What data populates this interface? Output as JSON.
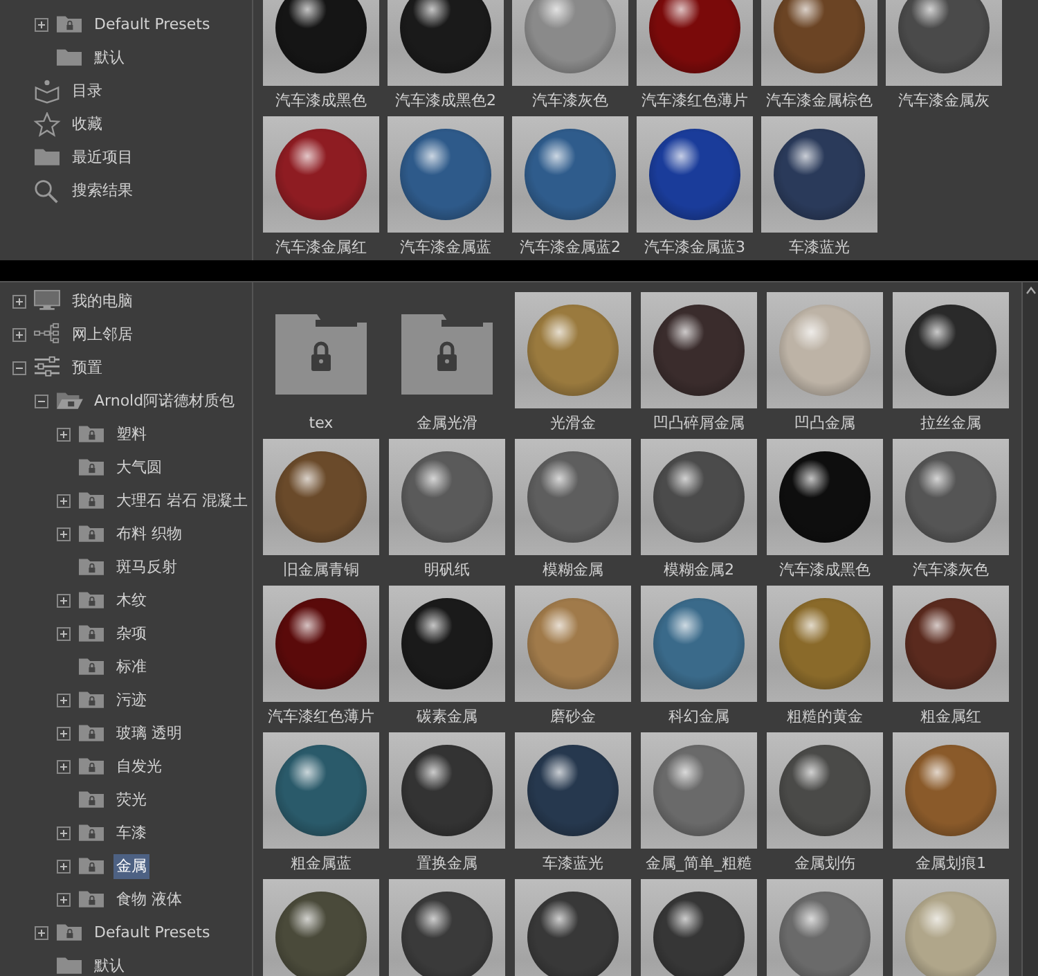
{
  "top_panel": {
    "tree": {
      "items": [
        {
          "children": [
            {
              "label": "Default Presets",
              "kind": "locked-folder",
              "expanded": false,
              "selected": false
            },
            {
              "label": "默认",
              "kind": "folder",
              "selected": false
            }
          ]
        },
        {
          "label": "目录",
          "kind": "book",
          "selected": false
        },
        {
          "label": "收藏",
          "kind": "star",
          "selected": false
        },
        {
          "label": "最近项目",
          "kind": "folder",
          "selected": false
        },
        {
          "label": "搜索结果",
          "kind": "search",
          "selected": false
        }
      ]
    },
    "grid": [
      {
        "kind": "material",
        "label": "汽车漆成黑色",
        "color": "#151515"
      },
      {
        "kind": "material",
        "label": "汽车漆成黑色2",
        "color": "#1a1a1a"
      },
      {
        "kind": "material",
        "label": "汽车漆灰色",
        "color": "#8a8a8a"
      },
      {
        "kind": "material",
        "label": "汽车漆红色薄片",
        "color": "#7a0a0a"
      },
      {
        "kind": "material",
        "label": "汽车漆金属棕色",
        "color": "#6b4424"
      },
      {
        "kind": "material",
        "label": "汽车漆金属灰",
        "color": "#4a4a4a"
      },
      {
        "kind": "material",
        "label": "汽车漆金属红",
        "color": "#8e1c22"
      },
      {
        "kind": "material",
        "label": "汽车漆金属蓝",
        "color": "#2e5a8a"
      },
      {
        "kind": "material",
        "label": "汽车漆金属蓝2",
        "color": "#2f5c8c"
      },
      {
        "kind": "material",
        "label": "汽车漆金属蓝3",
        "color": "#1a3c9a"
      },
      {
        "kind": "material",
        "label": "车漆蓝光",
        "color": "#2a3a5a"
      }
    ]
  },
  "bottom_panel": {
    "tree": {
      "items": [
        {
          "label": "我的电脑",
          "kind": "computer",
          "expanded": false,
          "selected": false
        },
        {
          "label": "网上邻居",
          "kind": "network",
          "expanded": false,
          "selected": false
        },
        {
          "label": "预置",
          "kind": "sliders",
          "expanded": true,
          "selected": false,
          "children": [
            {
              "label": "Arnold阿诺德材质包",
              "kind": "open-locked-folder",
              "expanded": true,
              "selected": false,
              "children": [
                {
                  "label": "塑料",
                  "kind": "locked-folder",
                  "expanded": false,
                  "selected": false
                },
                {
                  "label": "大气圆",
                  "kind": "locked-folder",
                  "selected": false
                },
                {
                  "label": "大理石 岩石 混凝土",
                  "kind": "locked-folder",
                  "expanded": false,
                  "selected": false
                },
                {
                  "label": "布料 织物",
                  "kind": "locked-folder",
                  "expanded": false,
                  "selected": false
                },
                {
                  "label": "斑马反射",
                  "kind": "locked-folder",
                  "selected": false
                },
                {
                  "label": "木纹",
                  "kind": "locked-folder",
                  "expanded": false,
                  "selected": false
                },
                {
                  "label": "杂项",
                  "kind": "locked-folder",
                  "expanded": false,
                  "selected": false
                },
                {
                  "label": "标准",
                  "kind": "locked-folder",
                  "selected": false
                },
                {
                  "label": "污迹",
                  "kind": "locked-folder",
                  "expanded": false,
                  "selected": false
                },
                {
                  "label": "玻璃 透明",
                  "kind": "locked-folder",
                  "expanded": false,
                  "selected": false
                },
                {
                  "label": "自发光",
                  "kind": "locked-folder",
                  "expanded": false,
                  "selected": false
                },
                {
                  "label": "荧光",
                  "kind": "locked-folder",
                  "selected": false
                },
                {
                  "label": "车漆",
                  "kind": "locked-folder",
                  "expanded": false,
                  "selected": false
                },
                {
                  "label": "金属",
                  "kind": "locked-folder",
                  "expanded": false,
                  "selected": true
                },
                {
                  "label": "食物 液体",
                  "kind": "locked-folder",
                  "expanded": false,
                  "selected": false
                }
              ]
            },
            {
              "label": "Default Presets",
              "kind": "locked-folder",
              "expanded": false,
              "selected": false
            },
            {
              "label": "默认",
              "kind": "folder",
              "selected": false
            }
          ]
        }
      ]
    },
    "grid": [
      {
        "kind": "folder",
        "label": "tex"
      },
      {
        "kind": "folder",
        "label": "金属光滑"
      },
      {
        "kind": "material",
        "label": "光滑金",
        "color": "#9a7a3e"
      },
      {
        "kind": "material",
        "label": "凹凸碎屑金属",
        "color": "#3a2c2c"
      },
      {
        "kind": "material",
        "label": "凹凸金属",
        "color": "#bdb3a6"
      },
      {
        "kind": "material",
        "label": "拉丝金属",
        "color": "#2a2a2a"
      },
      {
        "kind": "material",
        "label": "旧金属青铜",
        "color": "#6a4a2a"
      },
      {
        "kind": "material",
        "label": "明矾纸",
        "color": "#5a5a5a"
      },
      {
        "kind": "material",
        "label": "模糊金属",
        "color": "#5e5e5e"
      },
      {
        "kind": "material",
        "label": "模糊金属2",
        "color": "#4b4b4b"
      },
      {
        "kind": "material",
        "label": "汽车漆成黑色",
        "color": "#0e0e0e"
      },
      {
        "kind": "material",
        "label": "汽车漆灰色",
        "color": "#555555"
      },
      {
        "kind": "material",
        "label": "汽车漆红色薄片",
        "color": "#5a0a0a"
      },
      {
        "kind": "material",
        "label": "碳素金属",
        "color": "#1a1a1a"
      },
      {
        "kind": "material",
        "label": "磨砂金",
        "color": "#a07a4a"
      },
      {
        "kind": "material",
        "label": "科幻金属",
        "color": "#3a6a8a"
      },
      {
        "kind": "material",
        "label": "粗糙的黄金",
        "color": "#8a6a2a"
      },
      {
        "kind": "material",
        "label": "粗金属红",
        "color": "#5a2a1e"
      },
      {
        "kind": "material",
        "label": "粗金属蓝",
        "color": "#2a5a6a"
      },
      {
        "kind": "material",
        "label": "置换金属",
        "color": "#333333"
      },
      {
        "kind": "material",
        "label": "车漆蓝光",
        "color": "#26384e"
      },
      {
        "kind": "material",
        "label": "金属_简单_粗糙",
        "color": "#6a6a6a"
      },
      {
        "kind": "material",
        "label": "金属划伤",
        "color": "#4a4a48"
      },
      {
        "kind": "material",
        "label": "金属划痕1",
        "color": "#8a5a2a"
      },
      {
        "kind": "material",
        "color": "#4a4a3a"
      },
      {
        "kind": "material",
        "color": "#3a3a3a"
      },
      {
        "kind": "material",
        "color": "#383838"
      },
      {
        "kind": "material",
        "color": "#363636"
      },
      {
        "kind": "material",
        "color": "#6a6a6a"
      },
      {
        "kind": "material",
        "color": "#b0a68a"
      }
    ]
  }
}
